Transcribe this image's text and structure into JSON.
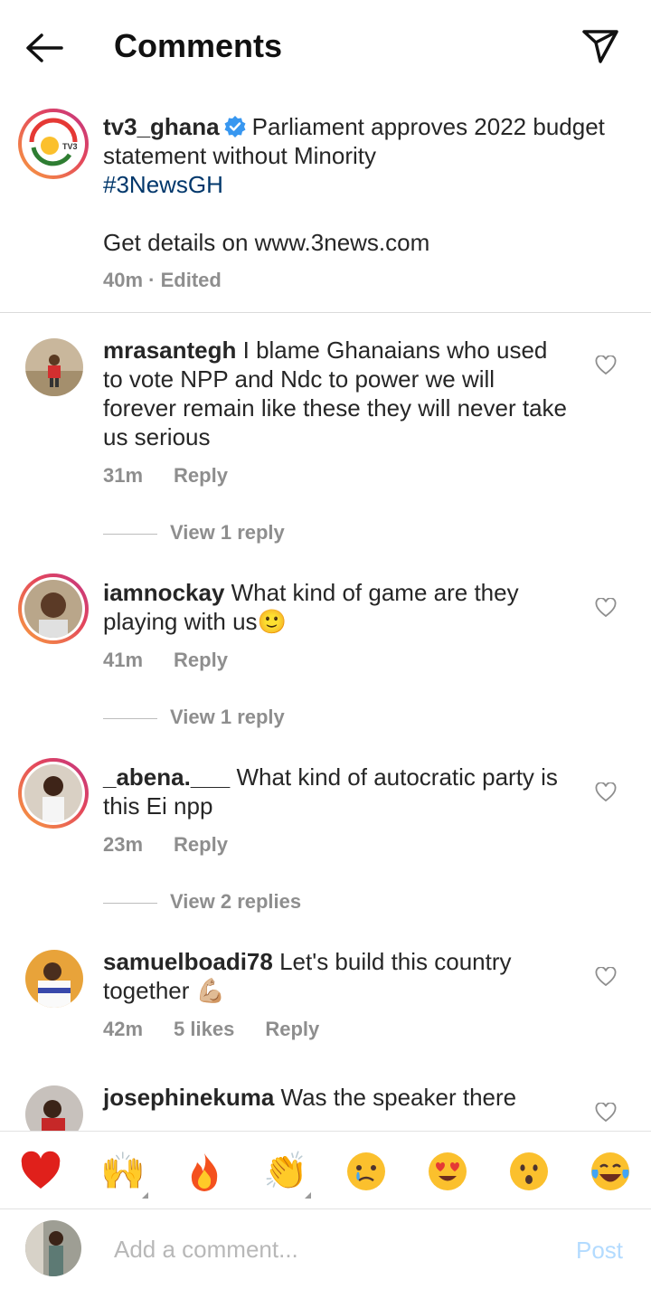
{
  "header": {
    "title": "Comments"
  },
  "caption": {
    "username": "tv3_ghana",
    "text_line1": "Parliament approves 2022 budget statement without Minority",
    "hashtag": "#3NewsGH",
    "text_line2": "Get details on www.3news.com",
    "time": "40m",
    "edited": "Edited",
    "avatar_logo_text": "TV3"
  },
  "comments": [
    {
      "username": "mrasantegh",
      "text": "I blame Ghanaians who used to vote NPP and Ndc to power we will forever remain like these they will never take us serious",
      "time": "31m",
      "reply": "Reply",
      "view_replies": "View 1 reply"
    },
    {
      "username": "iamnockay",
      "text": "What kind of game are they playing with us",
      "emoji": "🙂",
      "time": "41m",
      "reply": "Reply",
      "view_replies": "View 1 reply"
    },
    {
      "username": "_abena.___",
      "text": "What kind of autocratic party is this Ei npp",
      "time": "23m",
      "reply": "Reply",
      "view_replies": "View 2 replies"
    },
    {
      "username": "samuelboadi78",
      "text": "Let's build this country together",
      "emoji": "💪🏼",
      "time": "42m",
      "likes": "5 likes",
      "reply": "Reply"
    },
    {
      "username": "josephinekuma",
      "text": "Was the speaker there"
    }
  ],
  "emoji_bar": [
    "❤️",
    "🙌",
    "🔥",
    "👏",
    "😢",
    "😍",
    "😮",
    "😂"
  ],
  "add_comment": {
    "placeholder": "Add a comment...",
    "post_label": "Post"
  },
  "colors": {
    "hashtag": "#00376b",
    "verified": "#3897f0",
    "post_disabled": "#b3dbff",
    "meta": "#8e8e8e"
  }
}
